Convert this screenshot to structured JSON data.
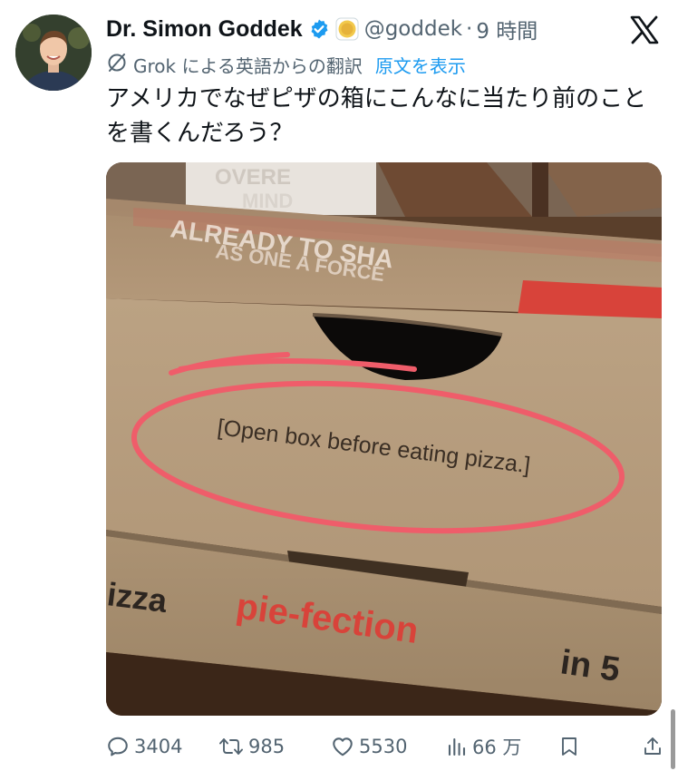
{
  "author": {
    "name": "Dr. Simon Goddek",
    "handle": "@goddek",
    "separator": "·",
    "time": "9 時間"
  },
  "translation": {
    "label": "Grok による英語からの翻訳",
    "show_original": "原文を表示"
  },
  "tweet": {
    "text": "アメリカでなぜピザの箱にこんなに当たり前のことを書くんだろう？"
  },
  "media": {
    "box_top_text_line1": "ALREADY TO SHA",
    "box_top_text_line2": "AS ONE A FORCE",
    "book_text_1": "OVERE",
    "book_text_2": "MIND",
    "circled_text": "[Open box before eating pizza.]",
    "side_text_black": "izza",
    "side_text_red": "pie-fection",
    "side_text_black2": "in 5"
  },
  "actions": {
    "replies": "3404",
    "reposts": "985",
    "likes": "5530",
    "views": "66 万"
  },
  "colors": {
    "link": "#1d9bf0",
    "verified": "#1d9bf0",
    "muted": "#536471",
    "circle": "#ef5d6a",
    "pizza_red": "#d8433a"
  }
}
